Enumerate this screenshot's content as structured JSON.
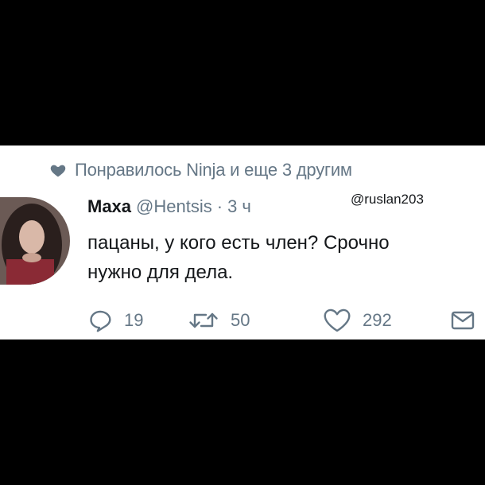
{
  "social_context": {
    "icon": "heart-icon",
    "text": "Понравилось Ninja и еще 3 другим"
  },
  "tweet": {
    "display_name": "Maxa",
    "handle": "@Hentsis",
    "separator": "·",
    "time": "3 ч",
    "watermark": "@ruslan203",
    "lines": [
      "пацаны, у кого есть член? Срочно",
      "нужно для дела."
    ]
  },
  "actions": {
    "reply": {
      "icon": "reply-icon",
      "count": "19"
    },
    "retweet": {
      "icon": "retweet-icon",
      "count": "50"
    },
    "like": {
      "icon": "heart-icon",
      "count": "292"
    },
    "dm": {
      "icon": "envelope-icon"
    }
  },
  "colors": {
    "background": "#000000",
    "card": "#ffffff",
    "text": "#14171a",
    "secondary": "#657786"
  }
}
